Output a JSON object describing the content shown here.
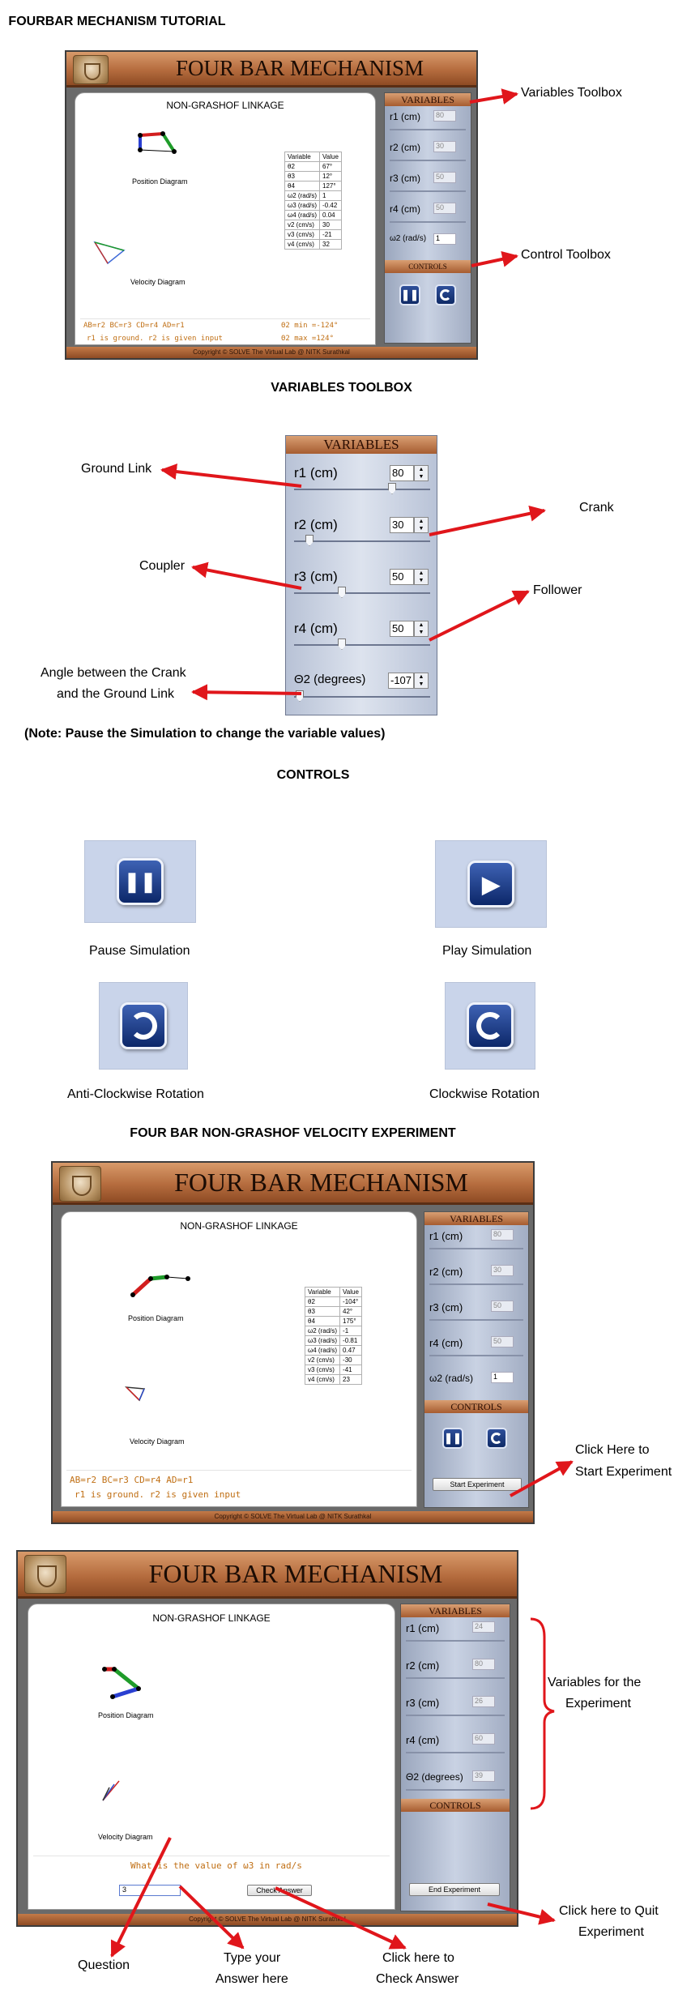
{
  "headings": {
    "tutorial": "FOURBAR MECHANISM TUTORIAL",
    "variables_toolbox": "VARIABLES TOOLBOX",
    "note": "(Note: Pause the Simulation to change the variable values)",
    "controls": "CONTROLS",
    "velocity_experiment": "FOUR BAR NON-GRASHOF VELOCITY EXPERIMENT"
  },
  "app": {
    "title": "FOUR BAR MECHANISM",
    "subtitle": "NON-GRASHOF LINKAGE",
    "position_diagram": "Position Diagram",
    "velocity_diagram": "Velocity Diagram",
    "footer": "Copyright © SOLVE The Virtual Lab @ NITK Surathkal",
    "variables_band": "VARIABLES",
    "controls_band": "CONTROLS",
    "var_labels": [
      "r1 (cm)",
      "r2 (cm)",
      "r3 (cm)",
      "r4 (cm)"
    ],
    "omega_label": "ω2 (rad/s)",
    "theta_label": "Θ2 (degrees)",
    "legend_line1": "AB=r2  BC=r3  CD=r4  AD=r1",
    "legend_line2": "r1 is ground. r2 is given input",
    "theta_min": "Θ2 min =-124°",
    "theta_max": "Θ2 max =124°",
    "table_headers": [
      "Variable",
      "Value"
    ],
    "start_experiment": "Start Experiment",
    "end_experiment": "End Experiment",
    "check_answer": "Check Answer",
    "question": "What is the value of ω3 in rad/s",
    "answer_value": "3"
  },
  "table1": [
    [
      "θ2",
      "67°"
    ],
    [
      "θ3",
      "12°"
    ],
    [
      "θ4",
      "127°"
    ],
    [
      "ω2 (rad/s)",
      "1"
    ],
    [
      "ω3 (rad/s)",
      "-0.42"
    ],
    [
      "ω4 (rad/s)",
      "0.04"
    ],
    [
      "v2 (cm/s)",
      "30"
    ],
    [
      "v3 (cm/s)",
      "-21"
    ],
    [
      "v4 (cm/s)",
      "32"
    ]
  ],
  "table2": [
    [
      "θ2",
      "-104°"
    ],
    [
      "θ3",
      "42°"
    ],
    [
      "θ4",
      "175°"
    ],
    [
      "ω2 (rad/s)",
      "-1"
    ],
    [
      "ω3 (rad/s)",
      "-0.81"
    ],
    [
      "ω4 (rad/s)",
      "0.47"
    ],
    [
      "v2 (cm/s)",
      "-30"
    ],
    [
      "v3 (cm/s)",
      "-41"
    ],
    [
      "v4 (cm/s)",
      "23"
    ]
  ],
  "omega_box": "1",
  "toolbox": {
    "band": "VARIABLES",
    "rows": [
      {
        "label": "r1 (cm)",
        "value": "80"
      },
      {
        "label": "r2 (cm)",
        "value": "30"
      },
      {
        "label": "r3 (cm)",
        "value": "50"
      },
      {
        "label": "r4 (cm)",
        "value": "50"
      },
      {
        "label": "Θ2 (degrees)",
        "value": "-107"
      }
    ]
  },
  "annotations": {
    "variables_toolbox": "Variables Toolbox",
    "control_toolbox": "Control Toolbox",
    "ground_link": "Ground Link",
    "crank": "Crank",
    "coupler": "Coupler",
    "follower": "Follower",
    "angle_line1": "Angle between the Crank",
    "angle_line2": "and the Ground Link",
    "start_line1": "Click Here to",
    "start_line2": "Start Experiment",
    "vars_exp_line1": "Variables for the",
    "vars_exp_line2": "Experiment",
    "quit_line1": "Click here to Quit",
    "quit_line2": "Experiment",
    "question": "Question",
    "type_line1": "Type your",
    "type_line2": "Answer here",
    "check_line1": "Click here to",
    "check_line2": "Check Answer"
  },
  "controls": {
    "pause": "Pause Simulation",
    "play": "Play Simulation",
    "acw": "Anti-Clockwise Rotation",
    "cw": "Clockwise Rotation"
  },
  "colors": {
    "title_copper": "#b56c3e",
    "panel_blue": "#c9d2e3",
    "button_blue": "#0f2a66",
    "annotation_red": "#e0161b",
    "legend_orange": "#c06f14"
  }
}
